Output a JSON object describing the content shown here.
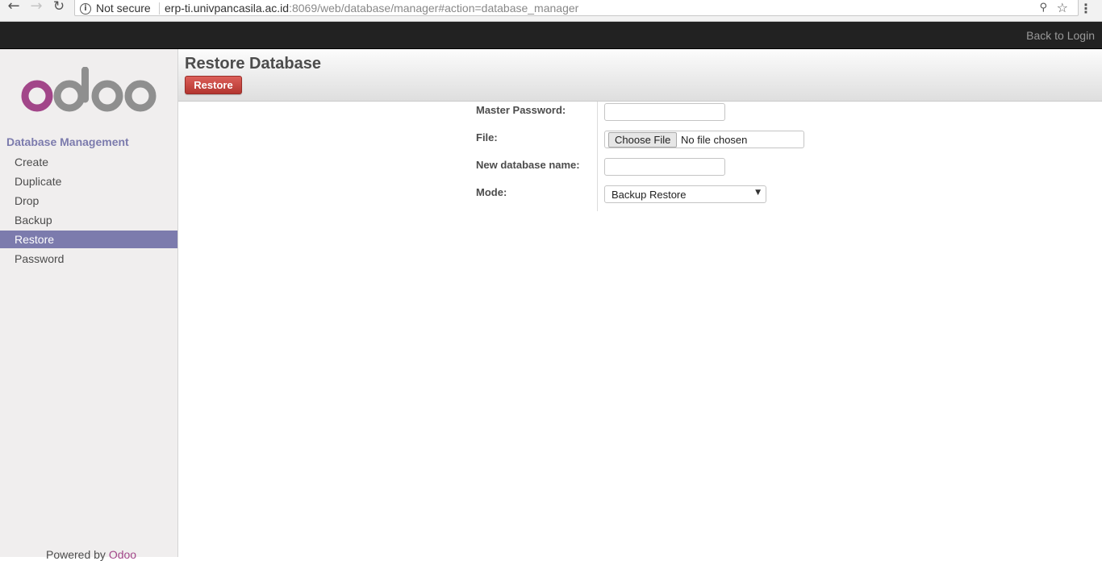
{
  "browser": {
    "security_label": "Not secure",
    "url_host": "erp-ti.univpancasila.ac.id",
    "url_path": ":8069/web/database/manager#action=database_manager"
  },
  "topbar": {
    "back_to_login": "Back to Login"
  },
  "sidebar": {
    "logo_text": "odoo",
    "section_title": "Database Management",
    "items": [
      {
        "label": "Create",
        "active": false
      },
      {
        "label": "Duplicate",
        "active": false
      },
      {
        "label": "Drop",
        "active": false
      },
      {
        "label": "Backup",
        "active": false
      },
      {
        "label": "Restore",
        "active": true
      },
      {
        "label": "Password",
        "active": false
      }
    ],
    "powered_by": "Powered by",
    "powered_brand": "Odoo"
  },
  "header": {
    "title": "Restore Database",
    "restore_button": "Restore"
  },
  "form": {
    "master_password_label": "Master Password:",
    "master_password_value": "",
    "file_label": "File:",
    "file_button": "Choose File",
    "file_status": "No file chosen",
    "new_db_label": "New database name:",
    "new_db_value": "",
    "mode_label": "Mode:",
    "mode_value": "Backup Restore"
  },
  "colors": {
    "brand_purple": "#7c7bad",
    "odoo_magenta": "#a24689",
    "restore_red": "#c13d36",
    "topbar": "#222222"
  }
}
